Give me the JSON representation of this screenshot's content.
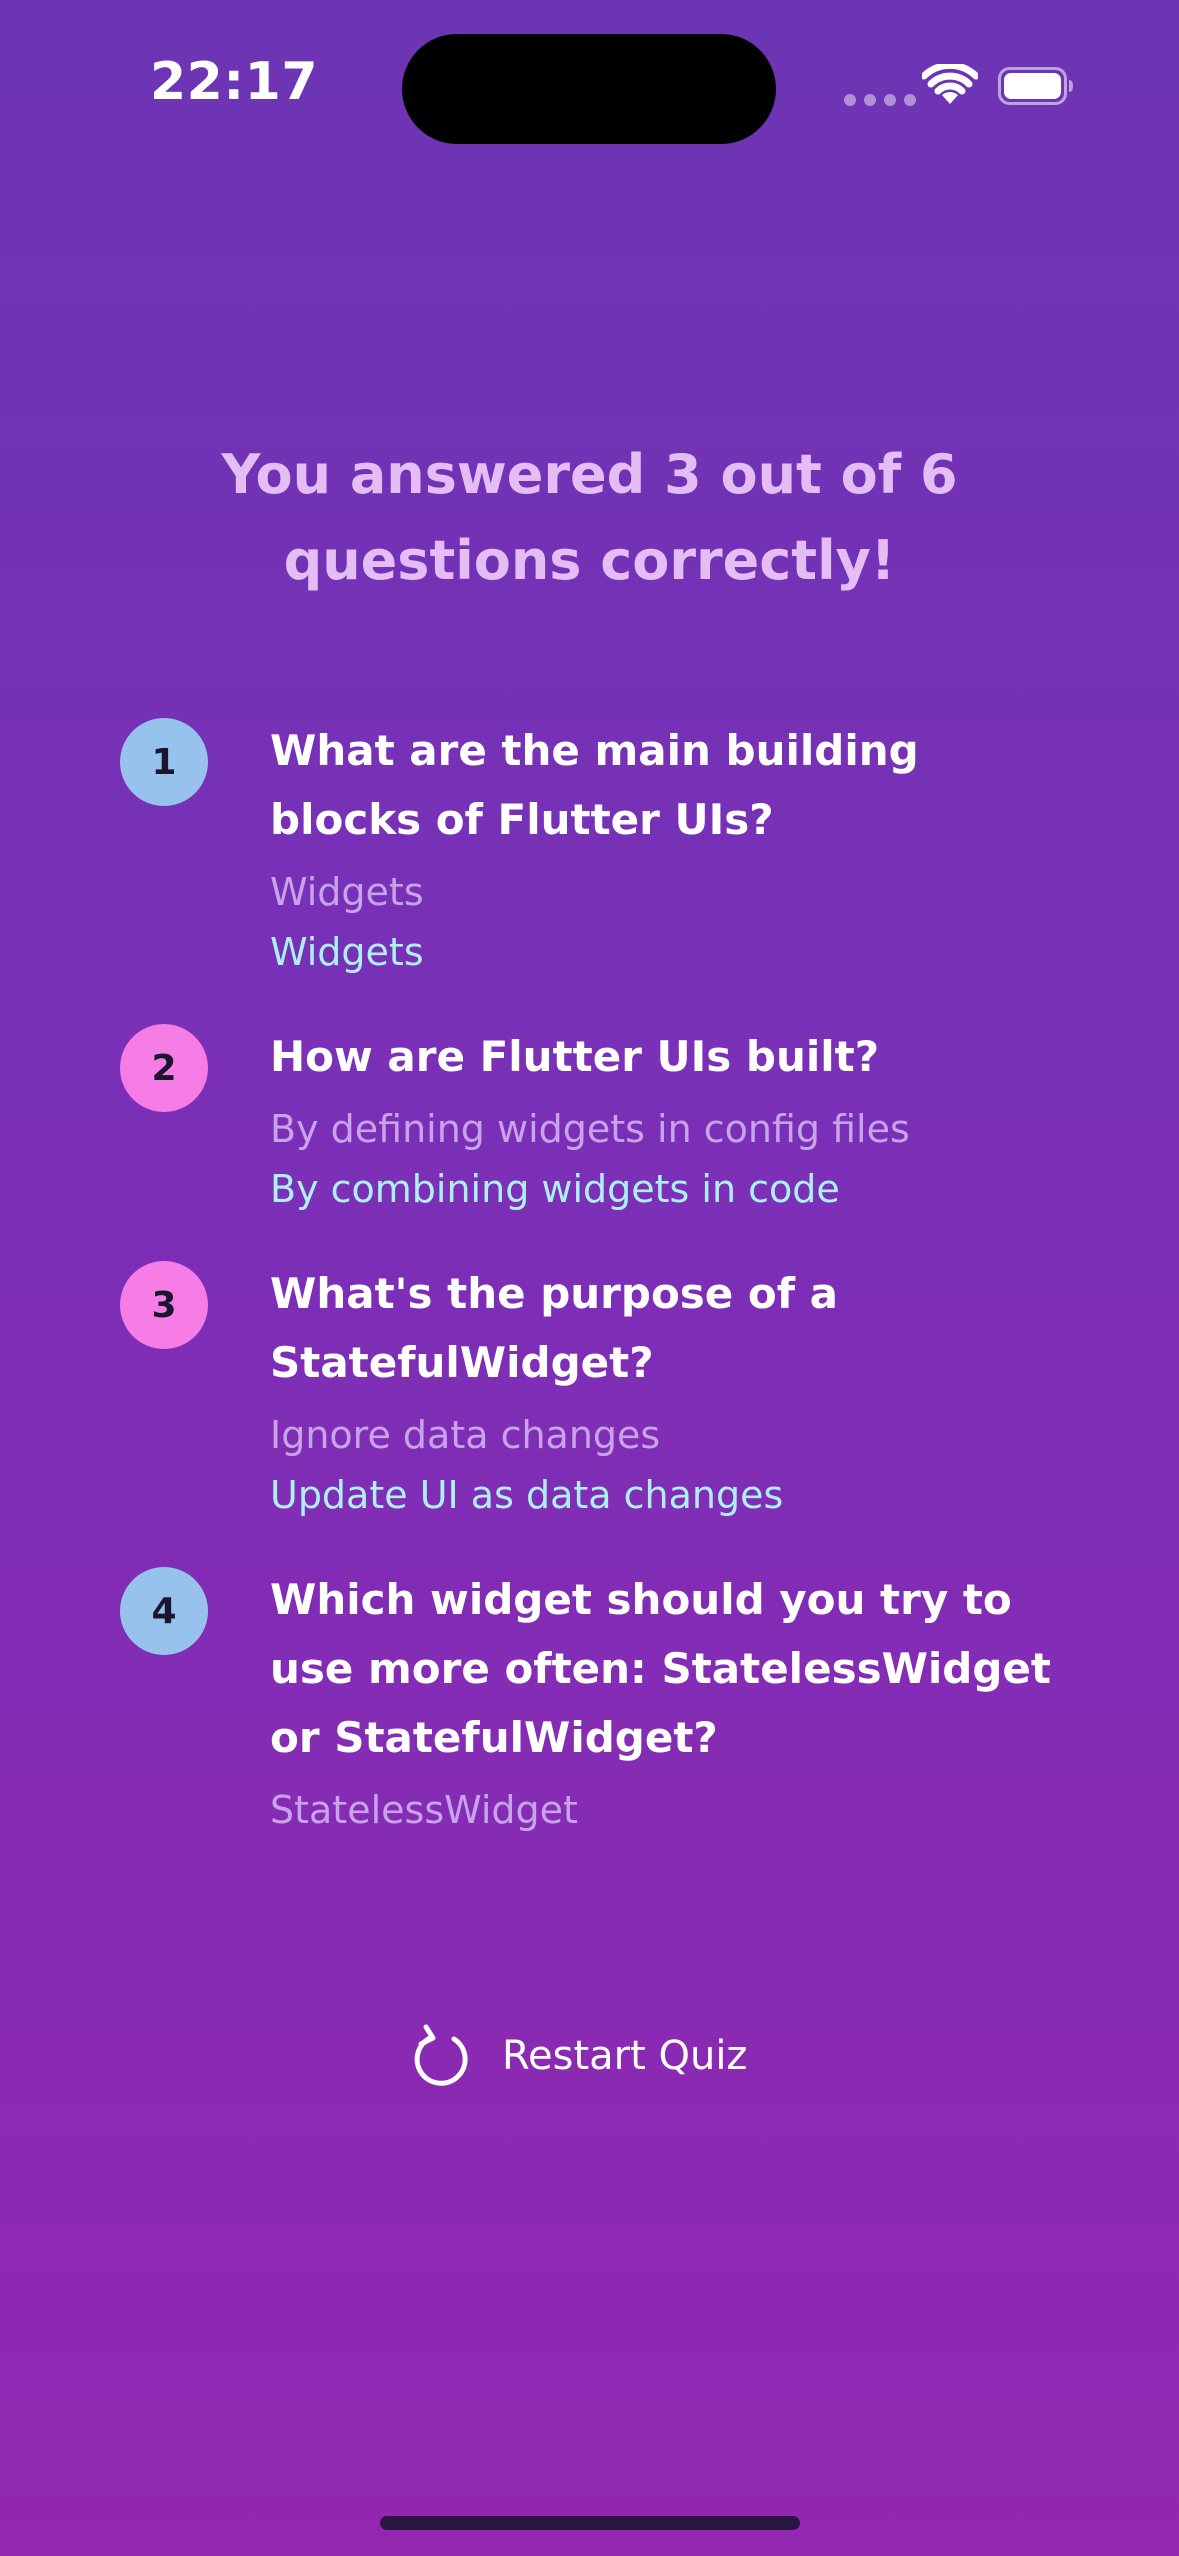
{
  "status_bar": {
    "time": "22:17",
    "icons": [
      "cellular-signal-icon",
      "wifi-icon",
      "battery-icon"
    ]
  },
  "headline": "You answered 3 out of 6 questions correctly!",
  "summary": [
    {
      "index": "1",
      "question": "What are the main building blocks of Flutter UIs?",
      "user_answer": "Widgets",
      "correct_answer": "Widgets",
      "is_correct": true
    },
    {
      "index": "2",
      "question": "How are Flutter UIs built?",
      "user_answer": "By defining widgets in config files",
      "correct_answer": "By combining widgets in code",
      "is_correct": false
    },
    {
      "index": "3",
      "question": "What's the purpose of a StatefulWidget?",
      "user_answer": "Ignore data changes",
      "correct_answer": "Update UI as data changes",
      "is_correct": false
    },
    {
      "index": "4",
      "question": "Which widget should you try to use more often: StatelessWidget or StatefulWidget?",
      "user_answer": "StatelessWidget",
      "correct_answer": "",
      "is_correct": true
    }
  ],
  "restart_button": {
    "label": "Restart Quiz",
    "icon": "refresh-icon"
  },
  "colors": {
    "background_top": "#6C35B4",
    "background_bottom": "#9227B1",
    "headline": "#E3BDF4",
    "correct_badge": "#96C2EC",
    "wrong_badge": "#F67DE6",
    "user_answer": "#C7A3EA",
    "correct_answer": "#AEEFF3"
  }
}
